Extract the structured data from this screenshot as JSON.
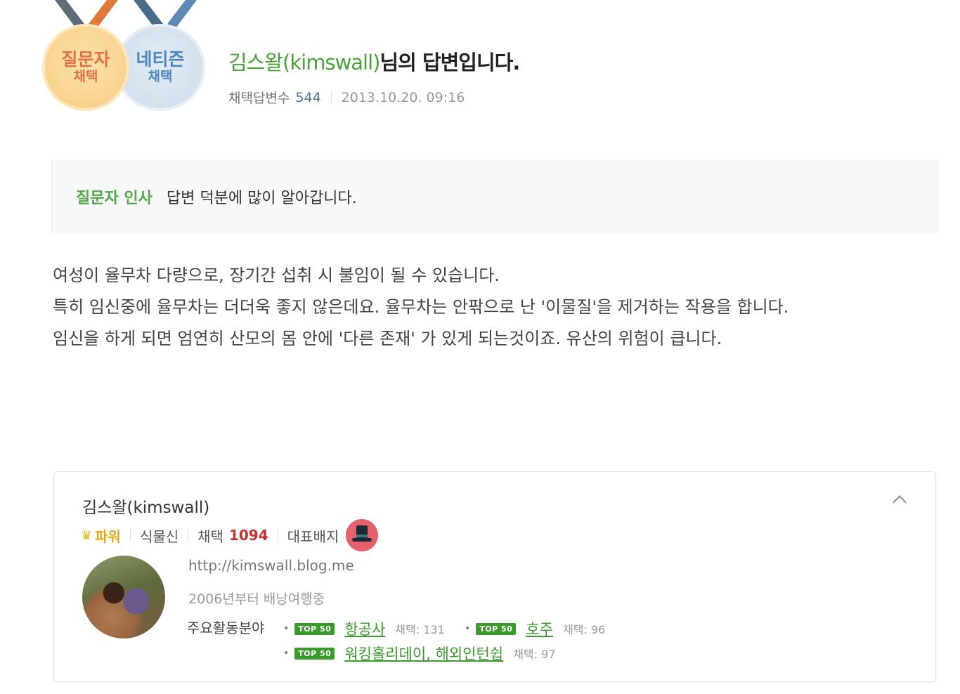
{
  "medals": {
    "questioner": {
      "line1": "질문자",
      "line2": "채택"
    },
    "netizen": {
      "line1": "네티즌",
      "line2": "채택"
    }
  },
  "header": {
    "username": "김스왈(kimswall)",
    "title_suffix": "님의 답변입니다.",
    "chosen_label": "채택답변수",
    "chosen_count": "544",
    "date": "2013.10.20. 09:16"
  },
  "greeting": {
    "label": "질문자 인사",
    "text": "답변 덕분에 많이 알아갑니다."
  },
  "answer": {
    "lines": [
      "여성이 율무차 다량으로, 장기간 섭취 시 불임이 될 수 있습니다.",
      "특히 임신중에 율무차는 더더욱 좋지 않은데요. 율무차는 안팎으로 난 '이물질'을 제거하는 작용을 합니다.",
      "임신을 하게 되면 엄연히 산모의 몸 안에 '다른 존재' 가 있게 되는것이죠. 유산의 위험이 큽니다."
    ]
  },
  "profile": {
    "name": "김스왈(kimswall)",
    "level": "파워",
    "category": "식물신",
    "chosen_label": "채택",
    "chosen_total": "1094",
    "badge_label": "대표배지",
    "url": "http://kimswall.blog.me",
    "intro": "2006년부터 배낭여행중",
    "fields_label": "주요활동분야",
    "fields": [
      {
        "tag": "TOP 50",
        "name": "항공사",
        "count": "채택: 131"
      },
      {
        "tag": "TOP 50",
        "name": "호주",
        "count": "채택: 96"
      },
      {
        "tag": "TOP 50",
        "name": "워킹홀리데이, 해외인턴쉽",
        "count": "채택: 97"
      }
    ]
  },
  "colors": {
    "accent_green": "#4aa13a",
    "level_gold": "#e3a91b",
    "chosen_red": "#c8302c",
    "medal_questioner": "#f8d28c",
    "medal_netizen": "#d1dfec"
  }
}
